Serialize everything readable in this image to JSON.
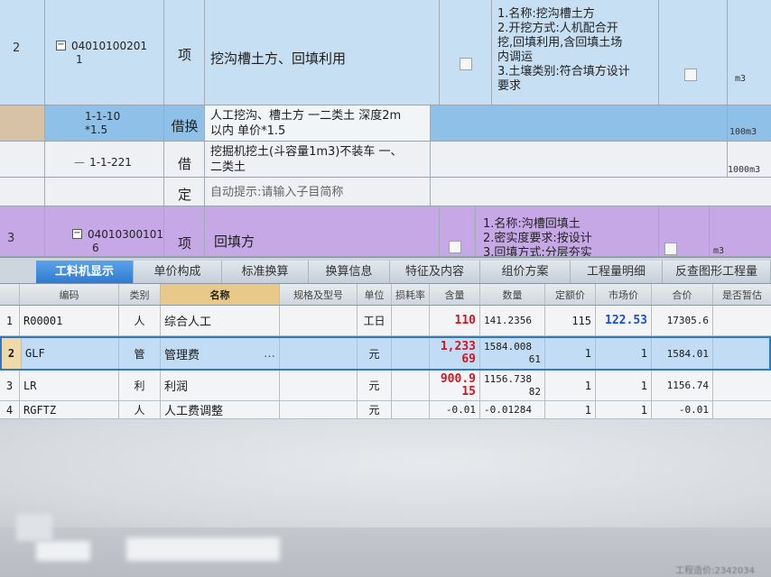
{
  "items": [
    {
      "num": "2",
      "code_line1": "04010100201",
      "code_line2": "1",
      "type": "项",
      "name": "挖沟槽土方、回填利用",
      "features": [
        "1.名称:挖沟槽土方",
        "2.开挖方式:人机配合开",
        "挖,回填利用,含回填土场",
        "内调运",
        "3.土壤类别:符合填方设计",
        "要求"
      ],
      "unit": "m3"
    },
    {
      "num": "3",
      "code_line1": "04010300101",
      "code_line2": "6",
      "type": "项",
      "name": "回填方",
      "features": [
        "1.名称:沟槽回填土",
        "2.密实度要求:按设计",
        "3.回填方式:分层夯实"
      ],
      "unit": "m3"
    }
  ],
  "subitems": [
    {
      "code_line1": "1-1-10",
      "code_line2": "*1.5",
      "type": "借换",
      "name_line1": "人工挖沟、槽土方 一二类土 深度2m",
      "name_line2": "以内  单价*1.5",
      "unit": "100m3"
    },
    {
      "code_line1": "1-1-221",
      "type": "借",
      "name_line1": "挖掘机挖土(斗容量1m3)不装车 一、",
      "name_line2": "二类土",
      "unit": "1000m3"
    },
    {
      "type": "定",
      "name_line1": "自动提示:请输入子目简称"
    }
  ],
  "tabs": [
    "工料机显示",
    "单价构成",
    "标准换算",
    "换算信息",
    "特征及内容",
    "组价方案",
    "工程量明细",
    "反查图形工程量"
  ],
  "table": {
    "headers": [
      "编码",
      "类别",
      "名称",
      "规格及型号",
      "单位",
      "损耗率",
      "含量",
      "数量",
      "定额价",
      "市场价",
      "合价",
      "是否暂估"
    ],
    "rows": [
      {
        "idx": "1",
        "code": "R00001",
        "cat": "人",
        "name": "综合人工",
        "unit": "工日",
        "content": "110",
        "qty_line1": "141.2356",
        "qty_line2": "",
        "quota": "115",
        "market": "122.53",
        "total": "17305.6"
      },
      {
        "idx": "2",
        "code": "GLF",
        "cat": "管",
        "name": "管理费",
        "unit": "元",
        "content": "1,233",
        "content_line2": "69",
        "qty_line1": "1584.008",
        "qty_line2": "61",
        "quota": "1",
        "market": "1",
        "total": "1584.01"
      },
      {
        "idx": "3",
        "code": "LR",
        "cat": "利",
        "name": "利润",
        "unit": "元",
        "content": "900.9",
        "content_line2": "15",
        "qty_line1": "1156.738",
        "qty_line2": "82",
        "quota": "1",
        "market": "1",
        "total": "1156.74"
      },
      {
        "idx": "4",
        "code": "RGFTZ",
        "cat": "人",
        "name": "人工费调整",
        "unit": "元",
        "content": "-0.01",
        "qty_line1": "-0.01284",
        "qty_line2": "",
        "quota": "1",
        "market": "1",
        "total": "-0.01"
      }
    ]
  },
  "footer_note": "工程造价:2342034"
}
